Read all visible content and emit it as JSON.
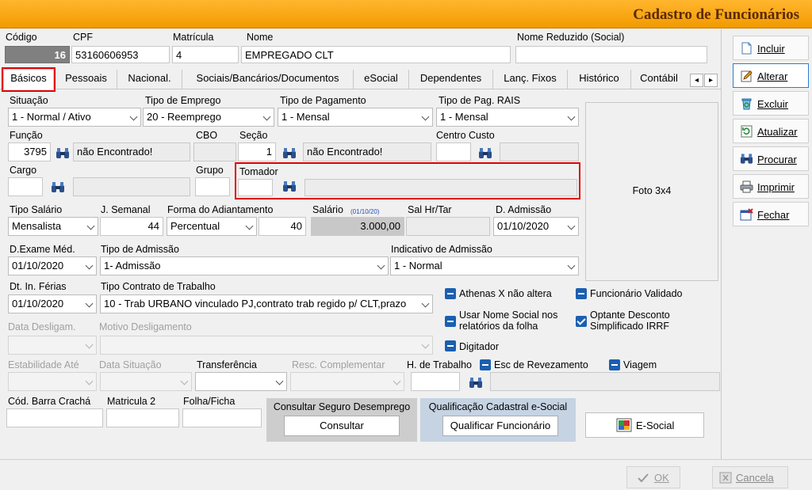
{
  "title": "Cadastro de Funcionários",
  "header": {
    "codigo_label": "Código",
    "codigo": "16",
    "cpf_label": "CPF",
    "cpf": "53160606953",
    "matricula_label": "Matrícula",
    "matricula": "4",
    "nome_label": "Nome",
    "nome": "EMPREGADO CLT",
    "nome_reduzido_label": "Nome Reduzido (Social)",
    "nome_reduzido": ""
  },
  "tabs": [
    "Básicos",
    "Pessoais",
    "Nacional.",
    "Sociais/Bancários/Documentos",
    "eSocial",
    "Dependentes",
    "Lanç. Fixos",
    "Histórico",
    "Contábil"
  ],
  "tab_scroll": {
    "left": "◂",
    "right": "▸"
  },
  "form": {
    "situacao_label": "Situação",
    "situacao": "1 - Normal / Ativo",
    "tipo_emprego_label": "Tipo de Emprego",
    "tipo_emprego": "20 - Reemprego",
    "tipo_pagamento_label": "Tipo de Pagamento",
    "tipo_pagamento": "1 - Mensal",
    "tipo_pag_rais_label": "Tipo de Pag. RAIS",
    "tipo_pag_rais": "1 - Mensal",
    "funcao_label": "Função",
    "funcao_code": "3795",
    "funcao_desc": "não Encontrado!",
    "cbo_label": "CBO",
    "cbo": "",
    "secao_label": "Seção",
    "secao_code": "1",
    "secao_desc": "não Encontrado!",
    "centro_custo_label": "Centro Custo",
    "cargo_label": "Cargo",
    "grupo_label": "Grupo",
    "tomador_label": "Tomador",
    "foto": "Foto 3x4",
    "tipo_salario_label": "Tipo Salário",
    "tipo_salario": "Mensalista",
    "j_semanal_label": "J. Semanal",
    "j_semanal": "44",
    "forma_adiantamento_label": "Forma do Adiantamento",
    "forma_adiantamento": "Percentual",
    "adiantamento_valor": "40",
    "salario_label": "Salário",
    "salario_date": "(01/10/20)",
    "salario": "3.000,00",
    "sal_hr_label": "Sal Hr/Tar",
    "d_admissao_label": "D. Admissão",
    "d_admissao": "01/10/2020",
    "d_exame_label": "D.Exame Méd.",
    "d_exame": "01/10/2020",
    "tipo_admissao_label": "Tipo de Admissão",
    "tipo_admissao": "1- Admissão",
    "indicativo_admissao_label": "Indicativo de Admissão",
    "indicativo_admissao": "1 - Normal",
    "dt_ferias_label": "Dt. In. Férias",
    "dt_ferias": "01/10/2020",
    "tipo_contrato_label": "Tipo Contrato de Trabalho",
    "tipo_contrato": "10 - Trab URBANO vinculado PJ,contrato trab regido p/ CLT,prazo",
    "data_deslig_label": "Data Desligam.",
    "motivo_deslig_label": "Motivo Desligamento",
    "estabilidade_label": "Estabilidade Até",
    "data_situacao_label": "Data Situação",
    "transferencia_label": "Transferência",
    "resc_complementar_label": "Resc. Complementar",
    "h_trabalho_label": "H. de Trabalho",
    "cod_barra_label": "Cód. Barra Crachá",
    "matricula2_label": "Matricula 2",
    "folha_ficha_label": "Folha/Ficha"
  },
  "checkboxes": {
    "athenas": "Athenas X não altera",
    "funcionario_validado": "Funcionário Validado",
    "nome_social_1": "Usar Nome Social nos",
    "nome_social_2": "relatórios da folha",
    "optante_1": "Optante Desconto",
    "optante_2": "Simplificado IRRF",
    "digitador": "Digitador",
    "escala": "Esc de Revezamento",
    "viagem": "Viagem"
  },
  "panels": {
    "seguro_title": "Consultar Seguro Desemprego",
    "seguro_button": "Consultar",
    "qualif_title": "Qualificação Cadastral e-Social",
    "qualif_button": "Qualificar Funcionário",
    "esocial_button": "E-Social"
  },
  "sidebar": [
    "Incluir",
    "Alterar",
    "Excluir",
    "Atualizar",
    "Procurar",
    "Imprimir",
    "Fechar"
  ],
  "footer": {
    "ok": "OK",
    "cancela": "Cancela"
  }
}
